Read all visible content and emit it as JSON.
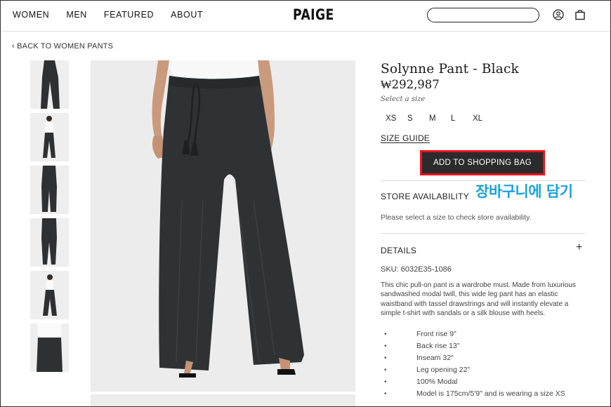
{
  "header": {
    "nav": [
      "WOMEN",
      "MEN",
      "FEATURED",
      "ABOUT"
    ],
    "logo": "PAIGE",
    "search": {
      "placeholder": "",
      "value": ""
    },
    "icons": [
      "account-icon",
      "shopping-bag-icon"
    ]
  },
  "breadcrumb": {
    "label": "BACK TO WOMEN PANTS"
  },
  "thumbnails": {
    "count": 6
  },
  "product": {
    "title": "Solynne Pant - Black",
    "price": "₩292,987",
    "select_size_label": "Select a size",
    "sizes": [
      "XS",
      "S",
      "M",
      "L",
      "XL"
    ],
    "size_guide": "SIZE GUIDE",
    "add_to_bag": "ADD TO SHOPPING BAG",
    "annotation": "장바구니에 담기",
    "store_availability": {
      "heading": "STORE AVAILABILITY",
      "note": "Please select a size to check store availability."
    },
    "details": {
      "heading": "DETAILS",
      "toggle": "+",
      "sku": "SKU: 6032E35-1086",
      "description": "This chic pull-on pant is a wardrobe must. Made from luxurious sandwashed modal twill, this wide leg pant has an elastic waistband with tassel drawstrings and will instantly elevate a simple t-shirt with sandals or a silk blouse with heels.",
      "bullet": "•",
      "features": [
        "Front rise 9\"",
        "Back rise 13\"",
        "Inseam 32\"",
        "Leg opening 22\"",
        "100% Modal",
        "Model is 175cm/5'9\" and is wearing a size XS"
      ]
    }
  },
  "colors": {
    "accent_highlight": "#e8141c",
    "annotation": "#1aa3d9",
    "button": "#2b2b2b"
  }
}
